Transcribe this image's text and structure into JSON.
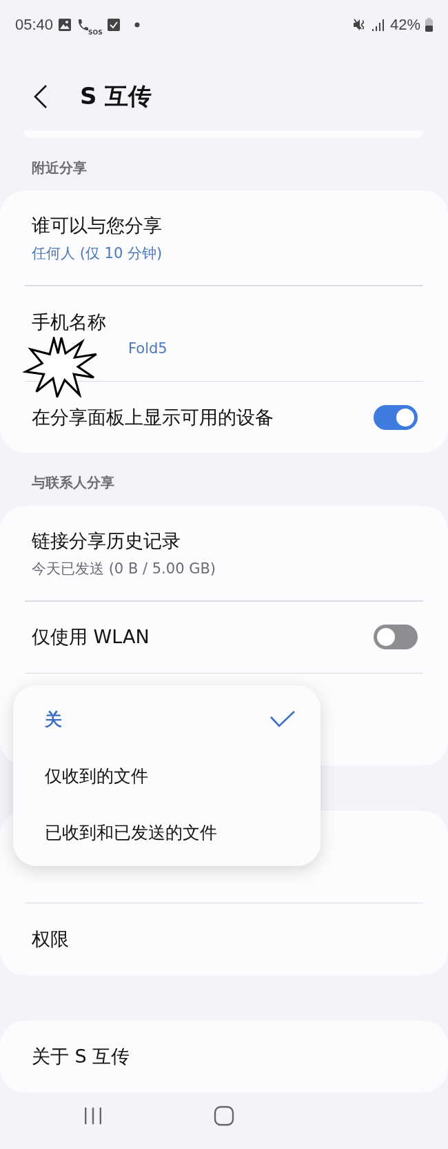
{
  "status_bar": {
    "time": "05:40",
    "sos_label": "SOS",
    "battery": "42%"
  },
  "header": {
    "title": "S 互传"
  },
  "sections": [
    {
      "label": "附近分享",
      "rows": [
        {
          "kind": "detail",
          "title": "谁可以与您分享",
          "subtitle": "任何人 (仅 10 分钟)"
        },
        {
          "kind": "detail",
          "title": "手机名称",
          "subtitle": "Fold5",
          "covered": true
        },
        {
          "kind": "toggle",
          "title": "在分享面板上显示可用的设备",
          "on": true
        }
      ]
    },
    {
      "label": "与联系人分享",
      "rows": [
        {
          "kind": "detail",
          "title": "链接分享历史记录",
          "subtitle": "今天已发送 (0 B / 5.00 GB)",
          "muted_subtitle": true
        },
        {
          "kind": "toggle",
          "title": "仅使用 WLAN",
          "on": false
        },
        {
          "kind": "hidden"
        }
      ]
    },
    {
      "rows": [
        {
          "kind": "hidden"
        },
        {
          "kind": "plain",
          "title": "权限"
        }
      ]
    },
    {
      "rows": [
        {
          "kind": "plain",
          "title": "关于 S 互传"
        }
      ]
    }
  ],
  "popup_menu": {
    "items": [
      {
        "label": "关",
        "selected": true
      },
      {
        "label": "仅收到的文件",
        "selected": false
      },
      {
        "label": "已收到和已发送的文件",
        "selected": false
      }
    ]
  }
}
